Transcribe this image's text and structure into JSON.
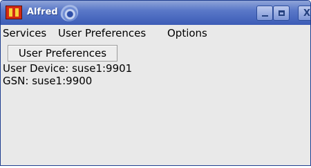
{
  "window": {
    "title": "Alfred",
    "buttons": [
      "minimize",
      "maximize",
      "close"
    ],
    "close_glyph": "X"
  },
  "menubar": {
    "items": [
      "Services",
      "User Preferences",
      "Options"
    ]
  },
  "content": {
    "button_label": "User Preferences",
    "user_device": "User Device: suse1:9901",
    "gsn": "GSN: suse1:9900"
  },
  "colors": {
    "titlebar": "#3c5cb6",
    "window_bg": "#e9e9e9",
    "app_icon": "#d42a14"
  },
  "icons": {
    "app": "alfred-app-icon",
    "swirl": "desktop-swirl-icon"
  }
}
